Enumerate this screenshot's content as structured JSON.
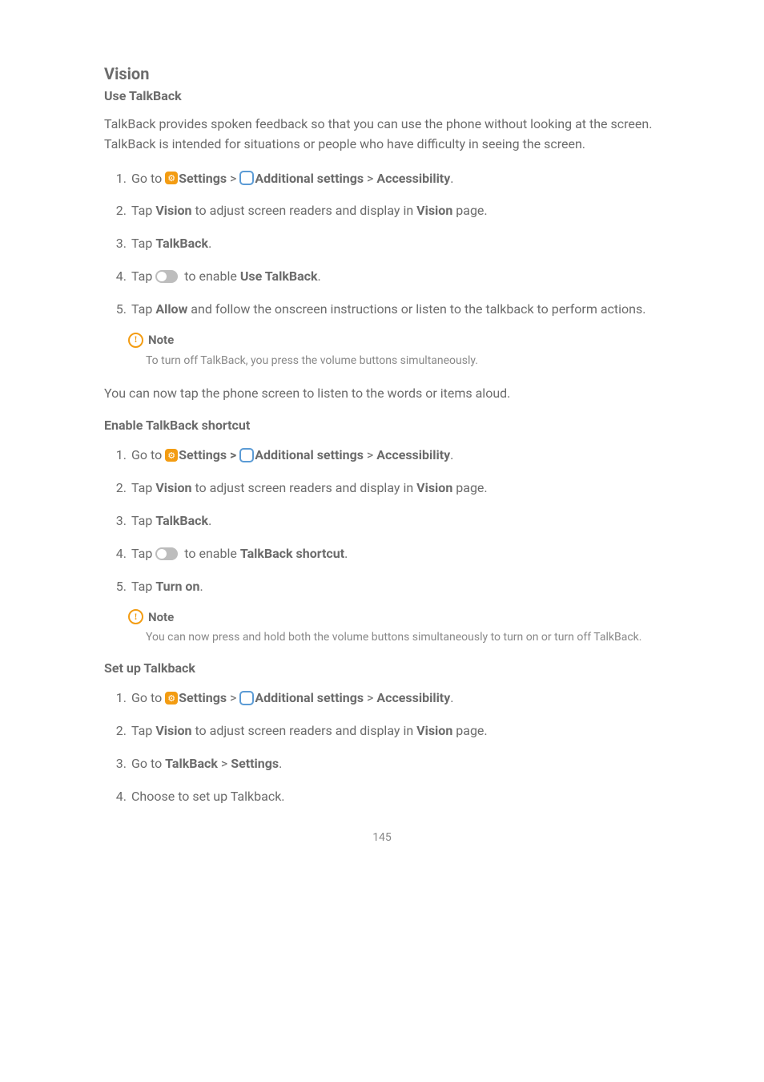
{
  "h2": "Vision",
  "section1": {
    "title": "Use TalkBack",
    "intro": "TalkBack provides spoken feedback so that you can use the phone without looking at the screen. TalkBack is intended for situations or people who have difficulty in seeing the screen.",
    "items": [
      {
        "num": "1.",
        "prefix": "Go to ",
        "settings": "Settings",
        "sep": " > ",
        "additional": "Additional settings",
        "sep2": " > ",
        "last": "Accessibility",
        "end": "."
      },
      {
        "num": "2.",
        "parts": [
          "Tap ",
          {
            "b": "Vision"
          },
          " to adjust screen readers and display in ",
          {
            "b": "Vision"
          },
          " page."
        ]
      },
      {
        "num": "3.",
        "parts": [
          "Tap ",
          {
            "b": "TalkBack"
          },
          "."
        ]
      },
      {
        "num": "4.",
        "toggle": true,
        "before": "Tap ",
        "after": " to enable ",
        "bold": "Use TalkBack",
        "end": "."
      },
      {
        "num": "5.",
        "parts": [
          "Tap ",
          {
            "b": "Allow"
          },
          " and follow the onscreen instructions or listen to the talkback to perform actions."
        ]
      }
    ],
    "note": {
      "title": "Note",
      "text": "To turn off TalkBack, you press the volume buttons simultaneously."
    },
    "outro": "You can now tap the phone screen to listen to the words or items aloud."
  },
  "section2": {
    "title": "Enable TalkBack shortcut",
    "items": [
      {
        "num": "1.",
        "prefix": "Go to ",
        "settings": "Settings",
        "sep": " > ",
        "additional": "Additional settings",
        "sep2": " > ",
        "last": "Accessibility",
        "end": "."
      },
      {
        "num": "2.",
        "parts": [
          "Tap ",
          {
            "b": "Vision"
          },
          " to adjust screen readers and display in ",
          {
            "b": "Vision"
          },
          " page."
        ]
      },
      {
        "num": "3.",
        "parts": [
          "Tap ",
          {
            "b": "TalkBack"
          },
          "."
        ]
      },
      {
        "num": "4.",
        "toggle": true,
        "before": "Tap ",
        "after": " to enable ",
        "bold": "TalkBack shortcut",
        "end": "."
      },
      {
        "num": "5.",
        "parts": [
          "Tap ",
          {
            "b": "Turn on"
          },
          "."
        ]
      }
    ],
    "note": {
      "title": "Note",
      "text": "You can now press and hold both the volume buttons simultaneously to turn on or turn off TalkBack."
    }
  },
  "section3": {
    "title": "Set up Talkback",
    "items": [
      {
        "num": "1.",
        "prefix": "Go to ",
        "settings": "Settings",
        "sep": " > ",
        "additional": "Additional settings",
        "sep2": " > ",
        "last": "Accessibility",
        "end": "."
      },
      {
        "num": "2.",
        "parts": [
          "Tap ",
          {
            "b": "Vision"
          },
          " to adjust screen readers and display in ",
          {
            "b": "Vision"
          },
          " page."
        ]
      },
      {
        "num": "3.",
        "parts": [
          "Go to ",
          {
            "b": "TalkBack"
          },
          " > ",
          {
            "b": "Settings"
          },
          "."
        ]
      },
      {
        "num": "4.",
        "parts": [
          "Choose to set up Talkback."
        ]
      }
    ]
  },
  "pageNumber": "145"
}
